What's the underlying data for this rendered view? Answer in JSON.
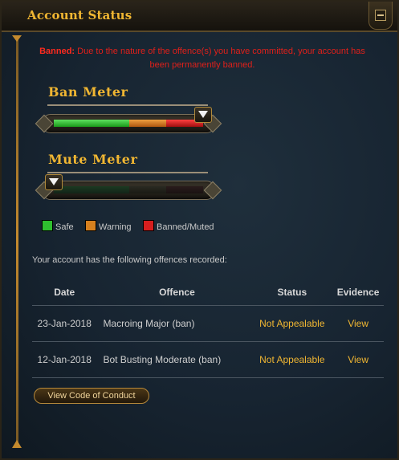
{
  "window": {
    "title": "Account Status"
  },
  "notice": {
    "label": "Banned:",
    "text": "Due to the nature of the offence(s) you have committed, your account has been permanently banned."
  },
  "ban_meter": {
    "title": "Ban Meter",
    "level": 1.0
  },
  "mute_meter": {
    "title": "Mute Meter",
    "level": 0.0
  },
  "legend": {
    "safe": "Safe",
    "warning": "Warning",
    "banned": "Banned/Muted",
    "colors": {
      "safe": "#2fbf2f",
      "warning": "#d6801e",
      "banned": "#d61e1e"
    }
  },
  "offences": {
    "intro": "Your account has the following offences recorded:",
    "columns": {
      "date": "Date",
      "offence": "Offence",
      "status": "Status",
      "evidence": "Evidence"
    },
    "rows": [
      {
        "date": "23-Jan-2018",
        "offence": "Macroing Major (ban)",
        "status": "Not Appealable",
        "evidence": "View"
      },
      {
        "date": "12-Jan-2018",
        "offence": "Bot Busting Moderate (ban)",
        "status": "Not Appealable",
        "evidence": "View"
      }
    ]
  },
  "conduct_button": "View Code of Conduct",
  "colors": {
    "accent": "#f0b632",
    "alert": "#e0201a"
  }
}
